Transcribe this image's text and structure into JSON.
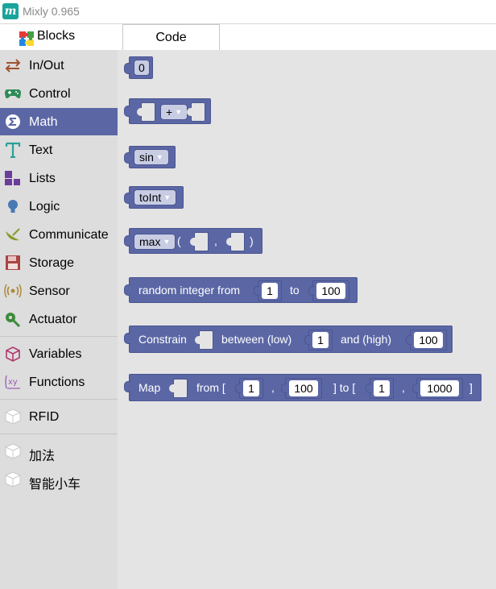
{
  "window": {
    "title": "Mixly 0.965",
    "icon": "mixly-logo-icon",
    "icon_letter": "m"
  },
  "tabs": {
    "blocks": "Blocks",
    "code": "Code"
  },
  "colors": {
    "accent": "#5b67a5",
    "toolbox_bg": "#dddddd",
    "workspace_bg": "#e4e4e4",
    "field_bg": "#c8cde3"
  },
  "toolbox": {
    "items": [
      {
        "label": "In/Out",
        "icon": "in-out-arrows-icon"
      },
      {
        "label": "Control",
        "icon": "gamepad-icon"
      },
      {
        "label": "Math",
        "icon": "math-sigma-icon",
        "selected": true
      },
      {
        "label": "Text",
        "icon": "letter-t-icon"
      },
      {
        "label": "Lists",
        "icon": "lists-squares-icon"
      },
      {
        "label": "Logic",
        "icon": "lightbulb-icon"
      },
      {
        "label": "Communicate",
        "icon": "satellite-dish-icon"
      },
      {
        "label": "Storage",
        "icon": "floppy-disk-icon"
      },
      {
        "label": "Sensor",
        "icon": "sensor-waves-icon"
      },
      {
        "label": "Actuator",
        "icon": "wrench-icon"
      },
      {
        "label": "Variables",
        "icon": "variables-cube-icon"
      },
      {
        "label": "Functions",
        "icon": "function-xy-icon"
      },
      {
        "label": "RFID",
        "icon": "cube-icon"
      },
      {
        "label": "加法",
        "icon": "cube-icon"
      },
      {
        "label": "智能小车",
        "icon": "cube-icon"
      }
    ]
  },
  "blocks": {
    "number": {
      "value": "0"
    },
    "arith": {
      "operator": "+"
    },
    "trig": {
      "function": "sin"
    },
    "convert": {
      "function": "toInt"
    },
    "maxmin": {
      "function": "max",
      "open": "(",
      "comma": ",",
      "close": ")"
    },
    "random": {
      "label": "random integer from",
      "from": "1",
      "to_label": "to",
      "to": "100"
    },
    "constrain": {
      "label": "Constrain",
      "between_label": "between (low)",
      "low": "1",
      "and_label": "and (high)",
      "high": "100"
    },
    "map": {
      "label": "Map",
      "from_label": "from [",
      "from_low": "1",
      "comma1": ",",
      "from_high": "100",
      "to_label": "] to [",
      "to_low": "1",
      "comma2": ",",
      "to_high": "1000",
      "close": "]"
    }
  }
}
